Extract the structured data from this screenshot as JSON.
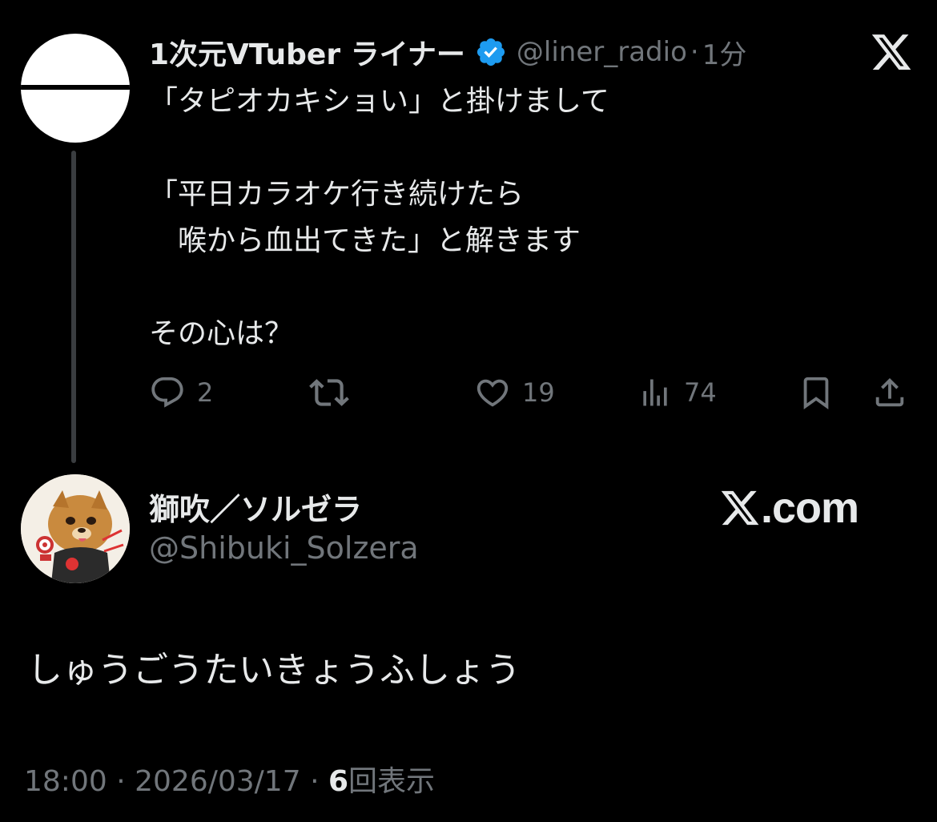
{
  "parent_tweet": {
    "display_name": "1次元VTuber ライナー",
    "handle": "@liner_radio",
    "separator": "·",
    "relative_time": "1分",
    "body": "「タピオカキショい」と掛けまして\n\n「平日カラオケ行き続けたら\n　喉から血出てきた」と解きます\n\nその心は？",
    "actions": {
      "replies": "2",
      "retweets": "",
      "likes": "19",
      "views": "74"
    }
  },
  "reply_tweet": {
    "display_name": "獅吹／ソルゼラ",
    "handle": "@Shibuki_Solzera",
    "body": "しゅうごうたいきょうふしょう",
    "time": "18:00",
    "date": "2026/03/17",
    "separator": "·",
    "views_count": "6",
    "views_label": "回表示"
  },
  "watermark": {
    "text": ".com"
  },
  "colors": {
    "background": "#000000",
    "text_primary": "#e7e9ea",
    "text_secondary": "#71767b",
    "verified_blue": "#1d9bf0",
    "thread_line": "#3a3d40"
  },
  "icons": {
    "verified": "verified-badge-icon",
    "x_logo": "x-logo-icon",
    "reply": "reply-icon",
    "retweet": "retweet-icon",
    "like": "heart-icon",
    "views": "views-icon",
    "bookmark": "bookmark-icon",
    "share": "share-icon"
  }
}
